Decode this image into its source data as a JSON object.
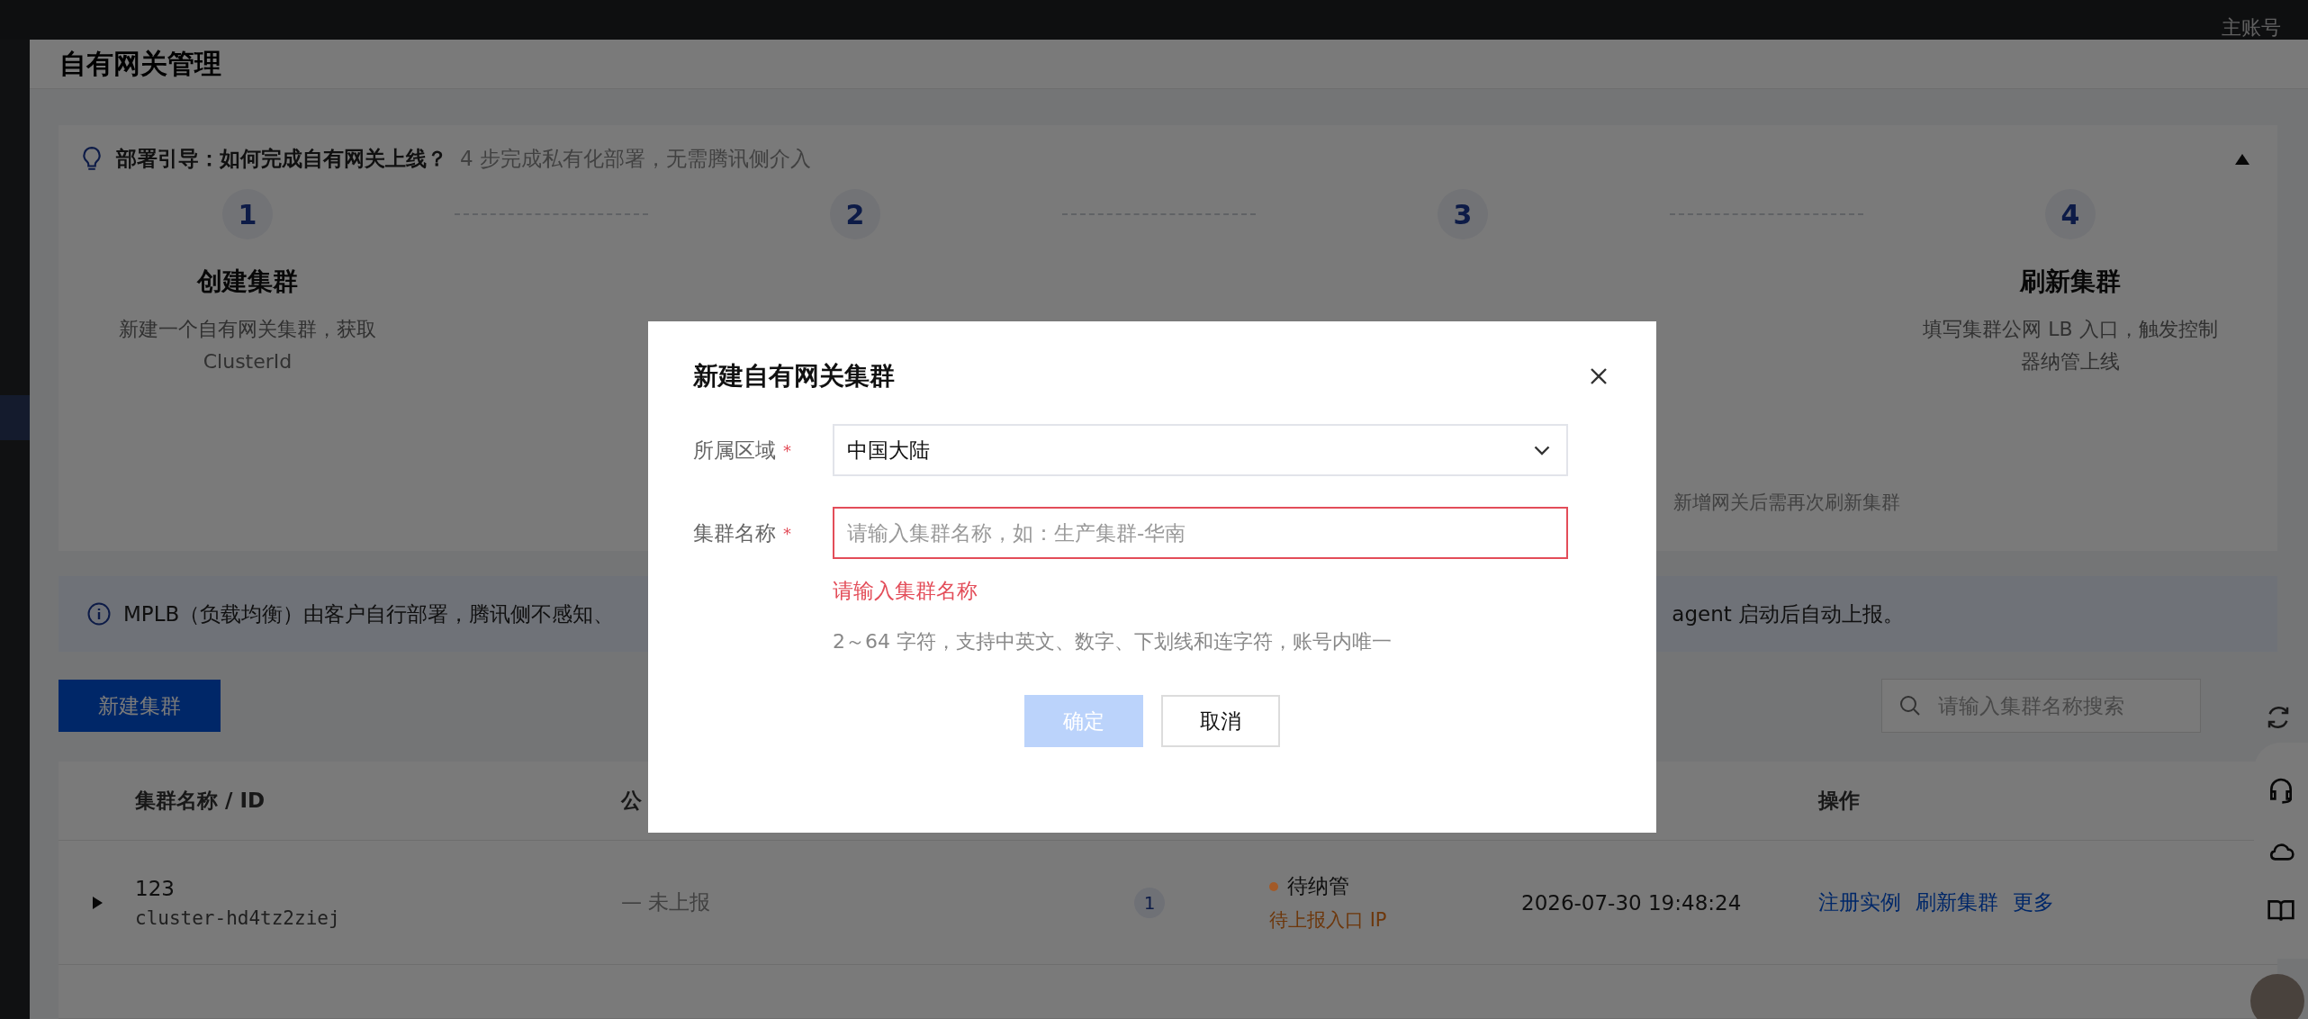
{
  "top_bar": {
    "account": "主账号"
  },
  "page": {
    "title": "自有网关管理"
  },
  "guide": {
    "title": "部署引导：如何完成自有网关上线？",
    "subtitle": "4 步完成私有化部署，无需腾讯侧介入",
    "expanded": true,
    "steps": [
      {
        "number": "1",
        "title": "创建集群",
        "description": "新建一个自有网关集群，获取 ClusterId"
      },
      {
        "number": "2"
      },
      {
        "number": "3",
        "note": "新增网关后需再次刷新集群"
      },
      {
        "number": "4",
        "title": "刷新集群",
        "description": "填写集群公网 LB 入口，触发控制器纳管上线"
      }
    ]
  },
  "notice": {
    "text_start": "MPLB（负载均衡）由客户自行部署，腾讯侧不感知、",
    "text_end": "agent 启动后自动上报。"
  },
  "toolbar": {
    "create_button": "新建集群",
    "search": {
      "placeholder": "请输入集群名称搜索"
    }
  },
  "table": {
    "header": {
      "name": "集群名称 / ID",
      "column_2": "公",
      "actions": "操作"
    },
    "rows": [
      {
        "expanded": false,
        "name": "123",
        "id": "cluster-hd4tz2ziej",
        "entry": "— 未上报",
        "instances": "1",
        "status": "待纳管",
        "color": "#a35a28",
        "status_note": "待上报入口 IP",
        "updated": "2026-07-30 19:48:24",
        "actions": [
          "注册实例",
          "刷新集群",
          "更多"
        ]
      }
    ]
  },
  "dialog": {
    "title": "新建自有网关集群",
    "fields": [
      {
        "kind": "select",
        "label": "所属区域",
        "required_mark": "*",
        "value": "中国大陆"
      },
      {
        "kind": "input",
        "label": "集群名称",
        "required_mark": "*",
        "placeholder": "请输入集群名称，如：生产集群-华南",
        "error": "请输入集群名称",
        "hint": "2～64 字符，支持中英文、数字、下划线和连字符，账号内唯一"
      }
    ],
    "buttons": [
      {
        "label": "确定",
        "kind": "primary",
        "disabled": true
      },
      {
        "label": "取消",
        "kind": "secondary",
        "disabled": false
      }
    ]
  }
}
